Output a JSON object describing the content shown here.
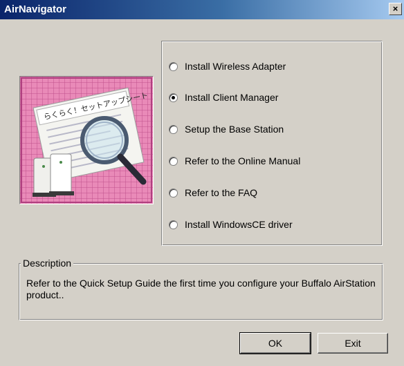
{
  "window": {
    "title": "AirNavigator",
    "close_label": "×"
  },
  "illustration": {
    "heading_text": "らくらく！セットアップシート"
  },
  "options": [
    {
      "label": "Install Wireless Adapter",
      "checked": false
    },
    {
      "label": "Install Client Manager",
      "checked": true
    },
    {
      "label": "Setup the Base Station",
      "checked": false
    },
    {
      "label": "Refer to the Online Manual",
      "checked": false
    },
    {
      "label": "Refer to the FAQ",
      "checked": false
    },
    {
      "label": "Install WindowsCE driver",
      "checked": false
    }
  ],
  "description": {
    "legend": "Description",
    "text": "Refer to the Quick Setup Guide the first time you configure your Buffalo AirStation product.."
  },
  "buttons": {
    "ok": "OK",
    "exit": "Exit"
  }
}
